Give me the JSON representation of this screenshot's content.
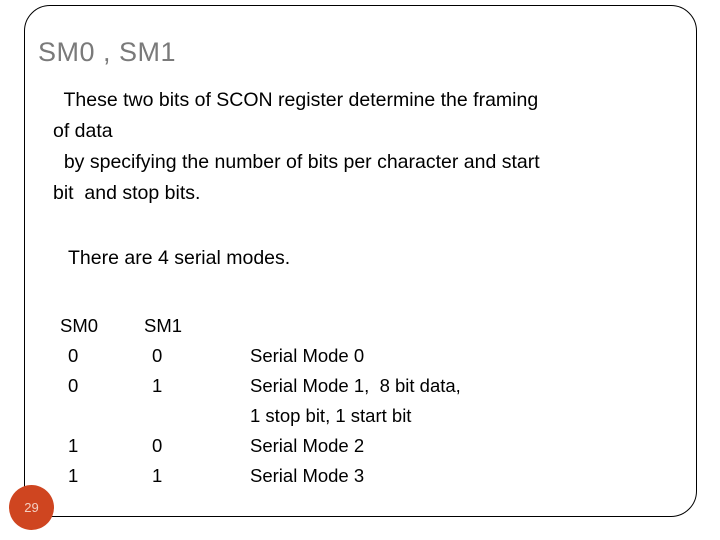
{
  "slide": {
    "title": "SM0 , SM1",
    "title_color": "#7a7a7a",
    "frame_color": "#000000",
    "background": "#ffffff"
  },
  "body": {
    "lines": [
      "  These two bits of SCON register determine the framing",
      "of data",
      "  by specifying the number of bits per character and start",
      "bit  and stop bits."
    ]
  },
  "modes_note": "There are 4 serial modes.",
  "table": {
    "headers": {
      "sm0": "SM0",
      "sm1": "SM1",
      "desc": ""
    },
    "rows": [
      {
        "sm0": "0",
        "sm1": "0",
        "desc": "Serial Mode 0"
      },
      {
        "sm0": "0",
        "sm1": "1",
        "desc": "Serial Mode 1,  8 bit data,"
      },
      {
        "sm0": "",
        "sm1": "",
        "desc": "1 stop bit, 1 start bit"
      },
      {
        "sm0": "1",
        "sm1": "0",
        "desc": "Serial Mode 2"
      },
      {
        "sm0": "1",
        "sm1": "1",
        "desc": "Serial Mode 3"
      }
    ]
  },
  "page_badge": {
    "number": "29",
    "fill_color": "#cf4520",
    "text_color": "#f3cfc2"
  }
}
